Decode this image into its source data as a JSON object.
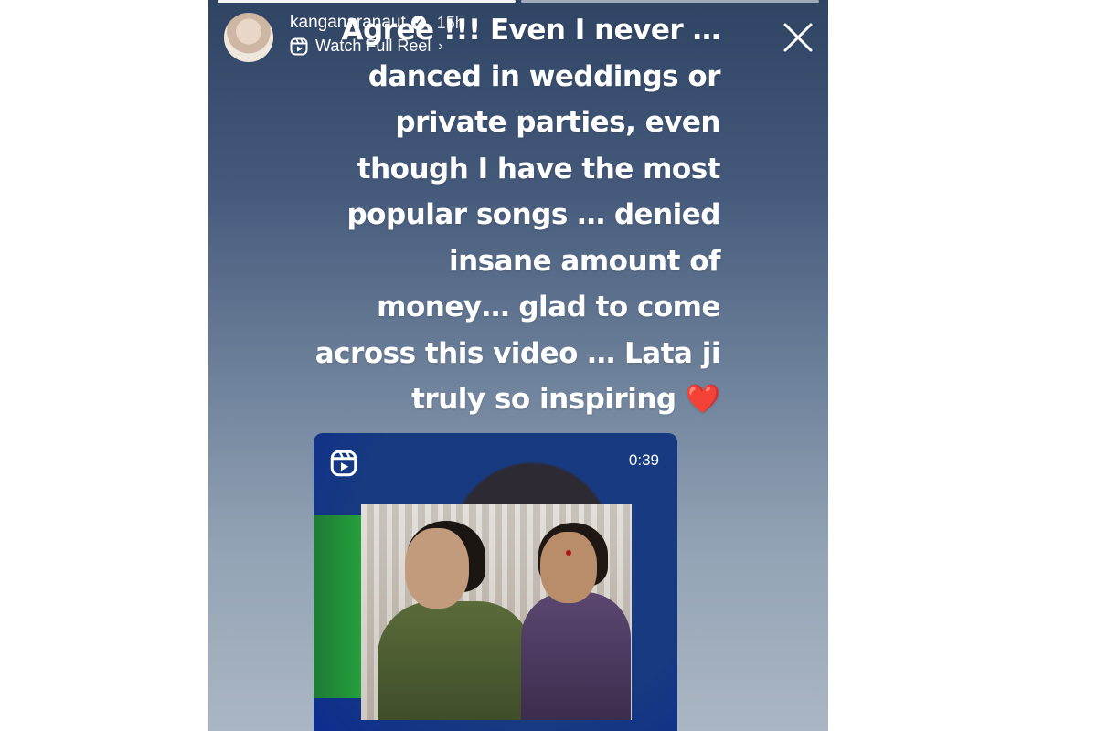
{
  "story": {
    "username": "kanganaranaut",
    "time_ago": "15h",
    "watch_label": "Watch Full Reel",
    "caption_lines": [
      "Agree !!! Even I never …",
      "danced in weddings or",
      "private parties, even",
      "though I have the most",
      "popular songs … denied",
      "insane amount of",
      "money… glad to come",
      "across this video … Lata ji",
      "truly so inspiring"
    ],
    "caption_emoji": "❤️",
    "reel": {
      "duration": "0:39"
    }
  },
  "icons": {
    "verified": "verified-badge-icon",
    "reel": "reel-icon",
    "close": "close-icon",
    "chevron": "chevron-right-icon"
  },
  "colors": {
    "heart": "#e02424"
  }
}
